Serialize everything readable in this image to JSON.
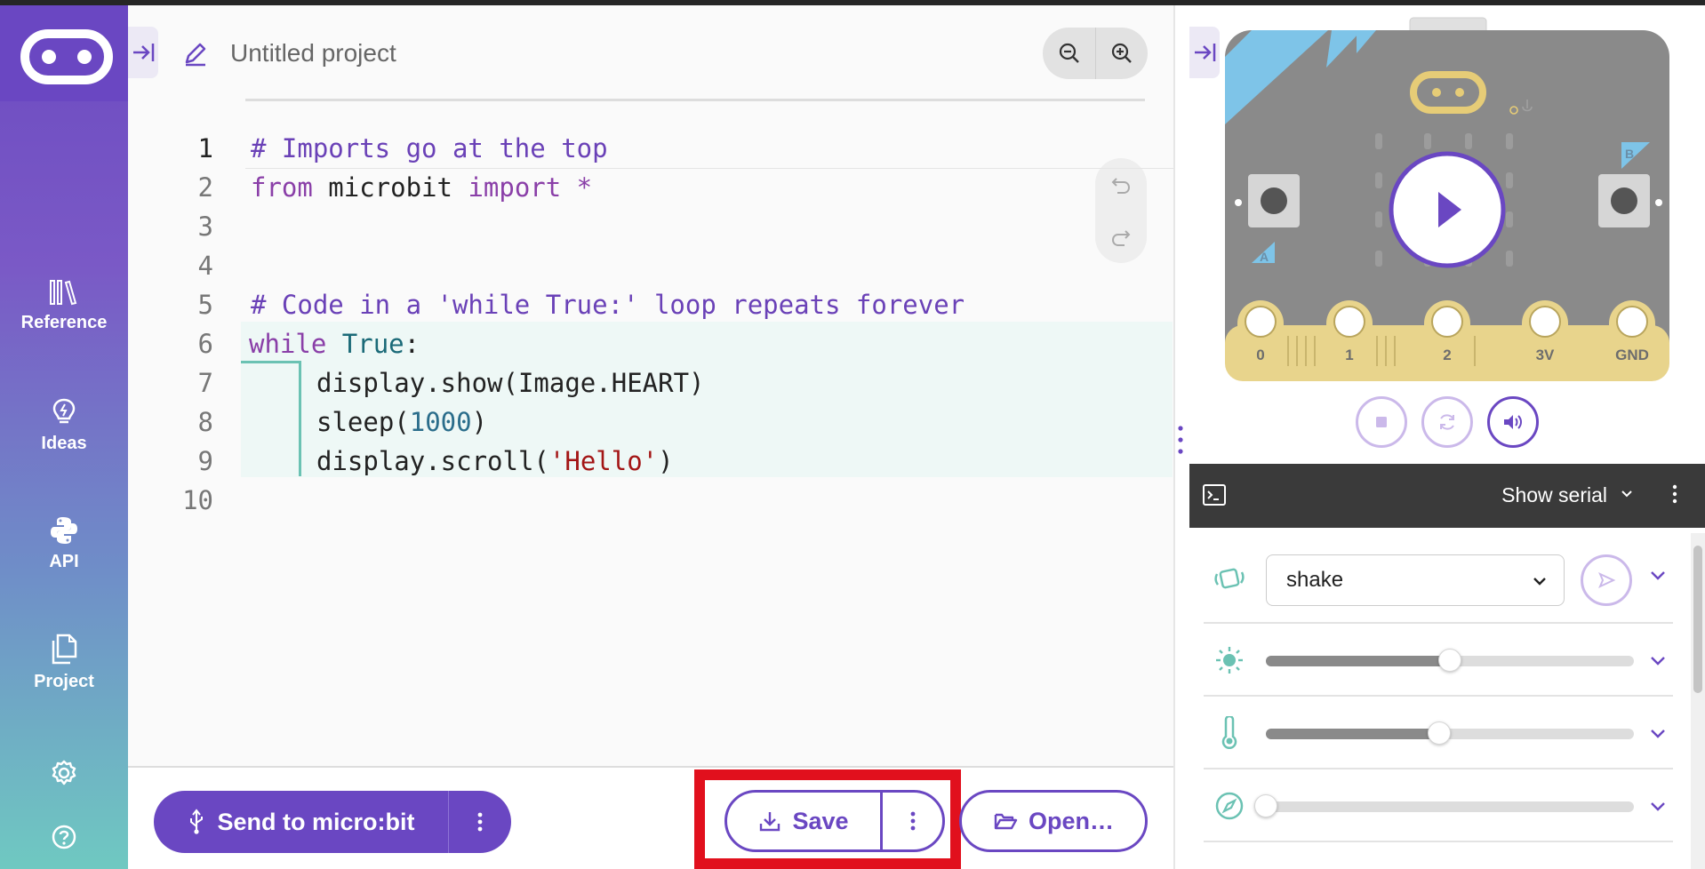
{
  "sidebar": {
    "items": [
      {
        "label": "Reference",
        "icon": "library-icon"
      },
      {
        "label": "Ideas",
        "icon": "lightbulb-icon"
      },
      {
        "label": "API",
        "icon": "python-icon"
      },
      {
        "label": "Project",
        "icon": "files-icon"
      }
    ]
  },
  "editor": {
    "project_title": "Untitled project",
    "code_lines": [
      "# Imports go at the top",
      "from microbit import *",
      "",
      "",
      "# Code in a 'while True:' loop repeats forever",
      "while True:",
      "    display.show(Image.HEART)",
      "    sleep(1000)",
      "    display.scroll('Hello')",
      ""
    ],
    "line_numbers": [
      "1",
      "2",
      "3",
      "4",
      "5",
      "6",
      "7",
      "8",
      "9",
      "10"
    ],
    "tokens": {
      "l1": "# Imports go at the top",
      "l2_kw1": "from",
      "l2_mod": " microbit ",
      "l2_kw2": "import",
      "l2_star": " *",
      "l5": "# Code in a 'while True:' loop repeats forever",
      "l6_kw": "while",
      "l6_true": " True",
      "l6_colon": ":",
      "l7": "display.show(Image.HEART)",
      "l8_a": "sleep(",
      "l8_num": "1000",
      "l8_b": ")",
      "l9_a": "display.scroll(",
      "l9_str": "'Hello'",
      "l9_b": ")"
    }
  },
  "toolbar": {
    "send_label": "Send to micro:bit",
    "save_label": "Save",
    "open_label": "Open…"
  },
  "simulator": {
    "pins": [
      "0",
      "1",
      "2",
      "3V",
      "GND"
    ],
    "button_a": "A",
    "button_b": "B"
  },
  "serial": {
    "label": "Show serial"
  },
  "sensors": {
    "gesture_value": "shake",
    "light_level": 0.5,
    "temperature_level": 0.47,
    "compass_level": 0.0
  },
  "colors": {
    "brand": "#6a47c2",
    "highlight": "#e1101d",
    "code_green": "#6bc2b3"
  }
}
